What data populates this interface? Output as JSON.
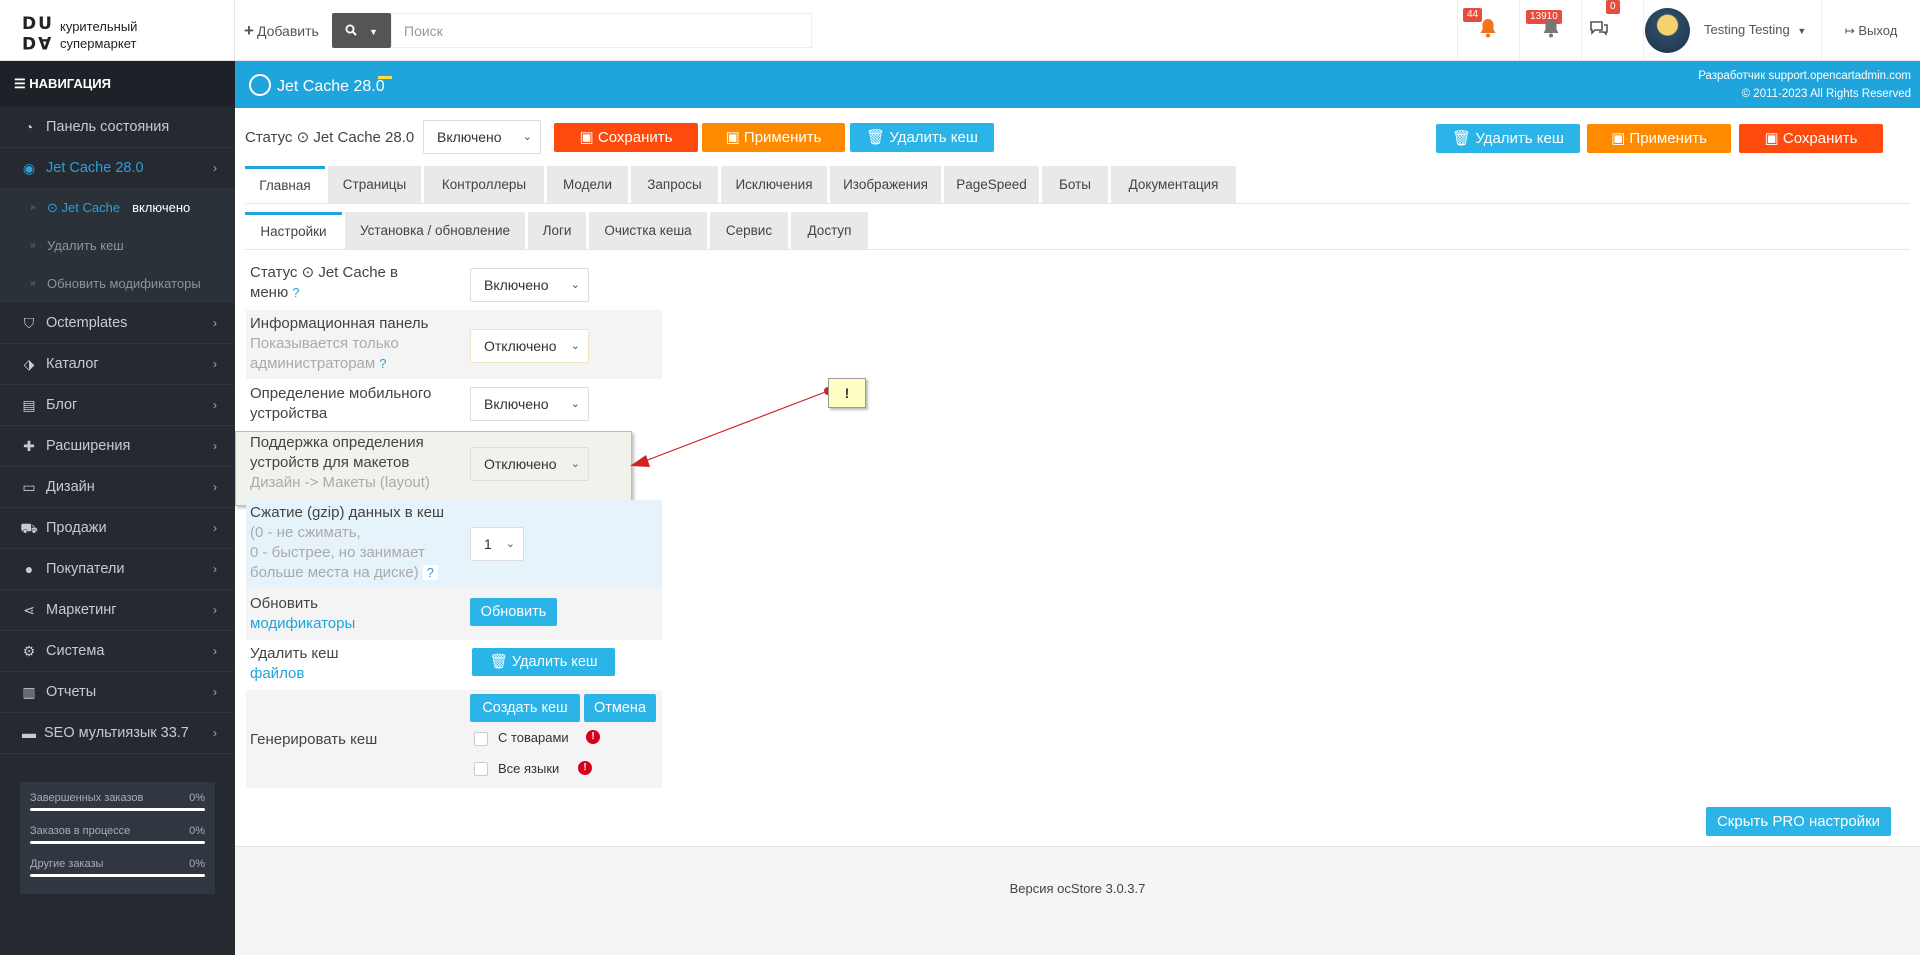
{
  "logo": {
    "mark_top": "DU",
    "mark_bottom": "DA",
    "line1": "курительный",
    "line2": "супермаркет"
  },
  "header": {
    "add_label": "Добавить",
    "search_placeholder": "Поиск",
    "badge_alerts": "44",
    "badge_orders": "13910",
    "badge_messages": "0",
    "user_name": "Testing Testing",
    "logout_label": "Выход"
  },
  "sidebar": {
    "nav_title": "НАВИГАЦИЯ",
    "items": [
      {
        "label": "Панель состояния",
        "icon": "dashboard-icon"
      },
      {
        "label": "Jet Cache 28.0",
        "icon": "jetcache-icon"
      },
      {
        "label": "Octemplates",
        "icon": "shield-icon"
      },
      {
        "label": "Каталог",
        "icon": "tags-icon"
      },
      {
        "label": "Блог",
        "icon": "book-icon"
      },
      {
        "label": "Расширения",
        "icon": "puzzle-icon"
      },
      {
        "label": "Дизайн",
        "icon": "desktop-icon"
      },
      {
        "label": "Продажи",
        "icon": "cart-icon"
      },
      {
        "label": "Покупатели",
        "icon": "user-icon"
      },
      {
        "label": "Маркетинг",
        "icon": "share-icon"
      },
      {
        "label": "Система",
        "icon": "cog-icon"
      },
      {
        "label": "Отчеты",
        "icon": "bar-chart-icon"
      },
      {
        "label": "SEO мультиязык 33.7",
        "icon": "card-icon"
      }
    ],
    "sub_items": [
      {
        "label": "Jet Cache",
        "extra": "включено"
      },
      {
        "label": "Удалить кеш"
      },
      {
        "label": "Обновить модификаторы"
      }
    ],
    "stats": [
      {
        "label": "Завершенных заказов",
        "value": "0%"
      },
      {
        "label": "Заказов в процессе",
        "value": "0%"
      },
      {
        "label": "Другие заказы",
        "value": "0%"
      }
    ]
  },
  "module_bar": {
    "title": "Jet Cache 28.0",
    "dev_line": "Разработчик support.opencartadmin.com",
    "copyright": "© 2011-2023 All Rights Reserved"
  },
  "toolbar": {
    "status_label": "Статус",
    "status_module": "Jet Cache 28.0",
    "status_value": "Включено",
    "save_label": "Сохранить",
    "apply_label": "Применить",
    "clear_label": "Удалить кеш"
  },
  "tabs_main": [
    "Главная",
    "Страницы",
    "Контроллеры",
    "Модели",
    "Запросы",
    "Исключения",
    "Изображения",
    "PageSpeed",
    "Боты",
    "Документация"
  ],
  "tabs_sub": [
    "Настройки",
    "Установка / обновление",
    "Логи",
    "Очистка кеша",
    "Сервис",
    "Доступ"
  ],
  "settings": {
    "menu_status": {
      "label_a": "Статус",
      "label_b": "Jet Cache в",
      "label_c": "меню",
      "value": "Включено"
    },
    "info_panel": {
      "label": "Информационная панель",
      "hint1": "Показывается только",
      "hint2": "администраторам",
      "value": "Отключено"
    },
    "mobile": {
      "label1": "Определение мобильного",
      "label2": "устройства",
      "value": "Включено"
    },
    "layout_support": {
      "label1": "Поддержка определения",
      "label2": "устройств для макетов",
      "hint": "Дизайн -> Макеты (layout)",
      "value": "Отключено"
    },
    "gzip": {
      "label": "Сжатие (gzip) данных в кеш",
      "hint1": "(0 - не сжимать,",
      "hint2": "0 - быстрее, но занимает",
      "hint3": "больше места на диске)",
      "value": "1"
    },
    "refresh": {
      "label": "Обновить",
      "link": "модификаторы",
      "button": "Обновить"
    },
    "delete_cache": {
      "label": "Удалить кеш",
      "link": "файлов",
      "button": "Удалить кеш"
    },
    "generate": {
      "label": "Генерировать кеш",
      "create_button": "Создать кеш",
      "cancel_button": "Отмена",
      "with_products": "С товарами",
      "all_languages": "Все языки"
    }
  },
  "question_mark": "?",
  "note_mark": "!",
  "hide_pro_label": "Скрыть PRO настройки",
  "footer_version": "Версия ocStore 3.0.3.7"
}
